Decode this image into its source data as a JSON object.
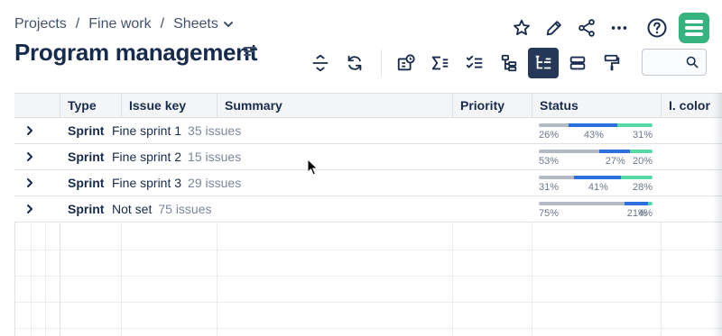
{
  "breadcrumb": {
    "items": [
      "Projects",
      "Fine work",
      "Sheets"
    ],
    "separator": "/"
  },
  "page": {
    "title": "Program management"
  },
  "top_icons": [
    "star-icon",
    "pencil-icon",
    "share-icon",
    "more-icon",
    "help-icon",
    "app-logo-icon"
  ],
  "toolbar_icons": [
    "collapse-rows-icon",
    "refresh-icon",
    "time-tracking-icon",
    "sum-icon",
    "checklist-icon",
    "hierarchy-icon",
    "structure-icon",
    "rows-icon",
    "format-painter-icon"
  ],
  "table": {
    "columns": [
      "Type",
      "Issue key",
      "Summary",
      "Priority",
      "Status",
      "I. color"
    ],
    "rows": [
      {
        "type": "Sprint",
        "name": "Fine sprint 1",
        "count": "35 issues",
        "status": {
          "todo": 26,
          "in_progress": 43,
          "done": 31
        },
        "labels": [
          "26%",
          "43%",
          "31%"
        ]
      },
      {
        "type": "Sprint",
        "name": "Fine sprint 2",
        "count": "15 issues",
        "status": {
          "todo": 53,
          "in_progress": 27,
          "done": 20
        },
        "labels": [
          "53%",
          "27%",
          "20%"
        ]
      },
      {
        "type": "Sprint",
        "name": "Fine sprint 3",
        "count": "29 issues",
        "status": {
          "todo": 31,
          "in_progress": 41,
          "done": 28
        },
        "labels": [
          "31%",
          "41%",
          "28%"
        ]
      },
      {
        "type": "Sprint",
        "name": "Not set",
        "count": "75 issues",
        "status": {
          "todo": 75,
          "in_progress": 21,
          "done": 4
        },
        "labels": [
          "75%",
          "21%",
          "4%"
        ]
      }
    ]
  },
  "colors": {
    "todo": "#b3bac5",
    "in_progress": "#2f6fdb",
    "done": "#57d9a3",
    "active_button": "#253858",
    "logo": "#36b37e"
  }
}
